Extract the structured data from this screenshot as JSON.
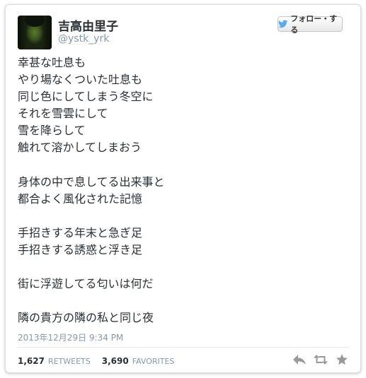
{
  "user": {
    "display_name": "吉高由里子",
    "screen_name": "@ystk_yrk"
  },
  "follow_button": {
    "label": "フォロー・する",
    "icon": "twitter-bird-icon"
  },
  "tweet": {
    "text": "幸甚な吐息も\nやり場なくついた吐息も\n同じ色にしてしまう冬空に\nそれを雪雲にして\n雪を降らして\n触れて溶かしてしまおう\n\n身体の中で息してる出来事と\n都合よく風化された記憶\n\n手招きする年末と急ぎ足\n手招きする誘惑と浮き足\n\n街に浮遊してる匂いは何だ\n\n隣の貴方の隣の私と同じ夜",
    "timestamp": "2013年12月29日  9:34 PM"
  },
  "stats": {
    "retweets_count": "1,627",
    "retweets_label": "RETWEETS",
    "favorites_count": "3,690",
    "favorites_label": "FAVORITES"
  },
  "actions": [
    {
      "name": "reply",
      "icon": "reply-icon"
    },
    {
      "name": "retweet",
      "icon": "retweet-icon"
    },
    {
      "name": "favorite",
      "icon": "star-icon"
    }
  ],
  "colors": {
    "text": "#292f33",
    "muted": "#8899a6",
    "brand": "#55acee",
    "icon": "#999999"
  }
}
